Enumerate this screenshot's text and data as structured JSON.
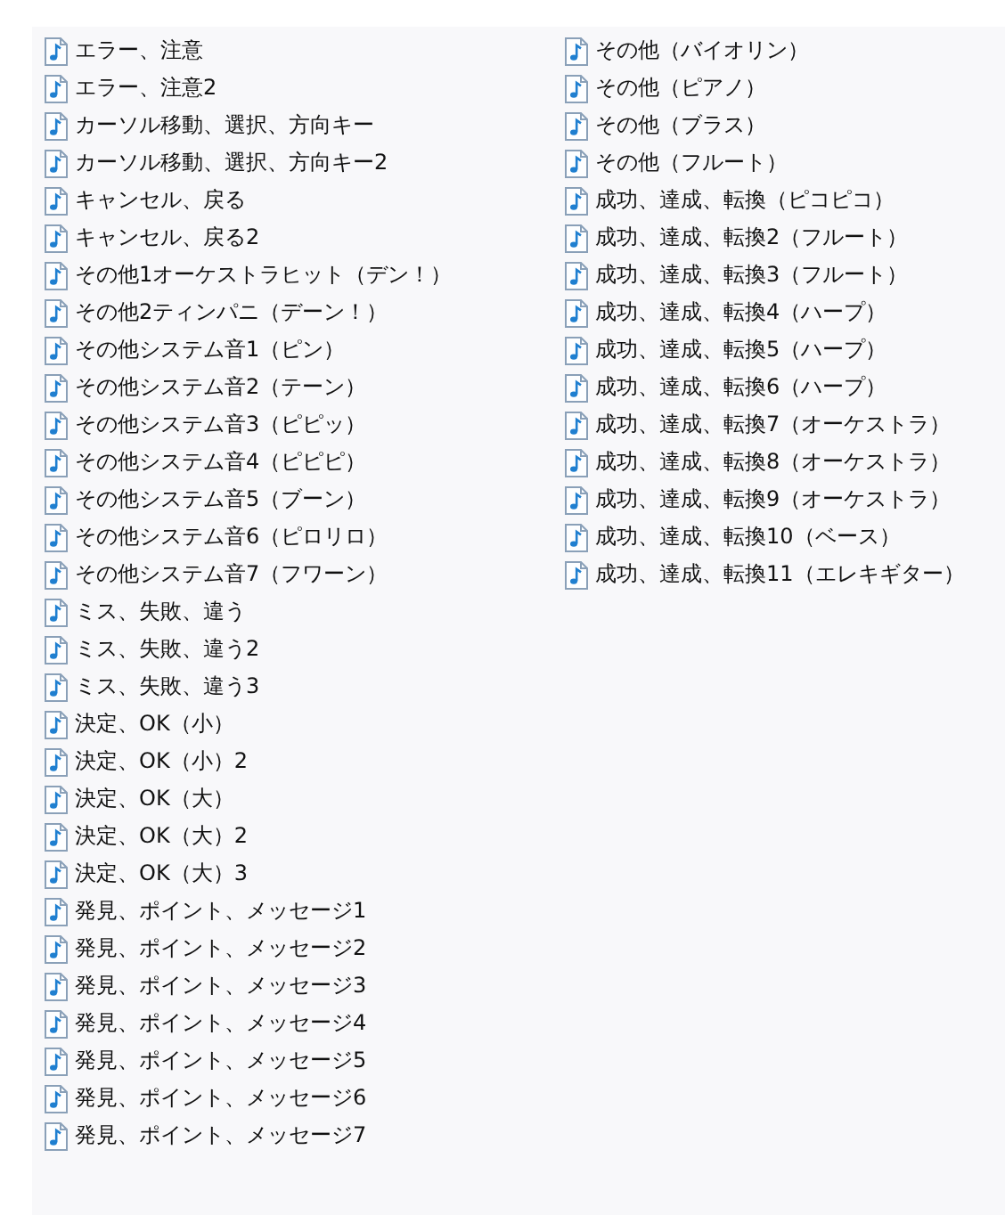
{
  "files": [
    "エラー、注意",
    "エラー、注意2",
    "カーソル移動、選択、方向キー",
    "カーソル移動、選択、方向キー2",
    "キャンセル、戻る",
    "キャンセル、戻る2",
    "その他1オーケストラヒット（デン！）",
    "その他2ティンパニ（デーン！）",
    "その他システム音1（ピン）",
    "その他システム音2（テーン）",
    "その他システム音3（ピピッ）",
    "その他システム音4（ピピピ）",
    "その他システム音5（ブーン）",
    "その他システム音6（ピロリロ）",
    "その他システム音7（フワーン）",
    "ミス、失敗、違う",
    "ミス、失敗、違う2",
    "ミス、失敗、違う3",
    "決定、OK（小）",
    "決定、OK（小）2",
    "決定、OK（大）",
    "決定、OK（大）2",
    "決定、OK（大）3",
    "発見、ポイント、メッセージ1",
    "発見、ポイント、メッセージ2",
    "発見、ポイント、メッセージ3",
    "発見、ポイント、メッセージ4",
    "発見、ポイント、メッセージ5",
    "発見、ポイント、メッセージ6",
    "発見、ポイント、メッセージ7",
    "その他（バイオリン）",
    "その他（ピアノ）",
    "その他（ブラス）",
    "その他（フルート）",
    "成功、達成、転換（ピコピコ）",
    "成功、達成、転換2（フルート）",
    "成功、達成、転換3（フルート）",
    "成功、達成、転換4（ハープ）",
    "成功、達成、転換5（ハープ）",
    "成功、達成、転換6（ハープ）",
    "成功、達成、転換7（オーケストラ）",
    "成功、達成、転換8（オーケストラ）",
    "成功、達成、転換9（オーケストラ）",
    "成功、達成、転換10（ベース）",
    "成功、達成、転換11（エレキギター）"
  ]
}
